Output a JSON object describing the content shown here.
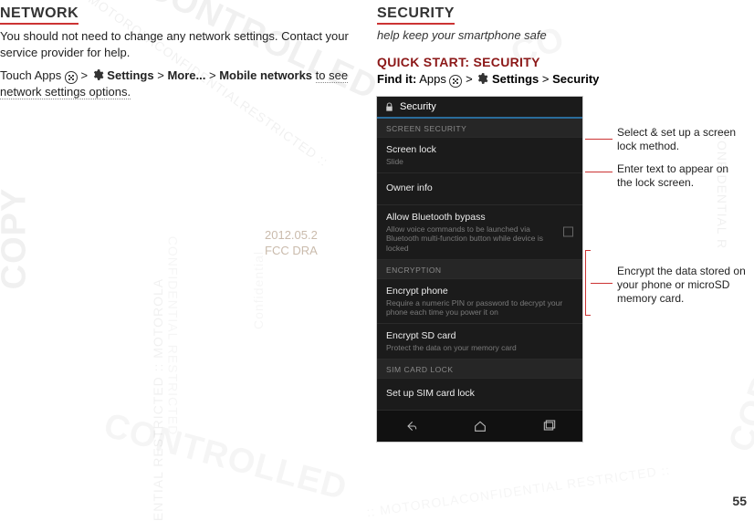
{
  "network": {
    "heading": "NETWORK",
    "body1": "You should not need to change any network settings. Contact your service provider for help.",
    "body2_pre": "Touch Apps ",
    "body2_gt1": " > ",
    "settings_label": "Settings",
    "body2_gt2": " > ",
    "more_label": "More...",
    "body2_gt3": " > ",
    "mobile_networks_label": "Mobile networks",
    "body2_post": " to see network settings options."
  },
  "security": {
    "heading": "SECURITY",
    "subtitle": "help keep your smartphone safe",
    "quick_heading": "QUICK START: SECURITY",
    "findit_label": "Find it:",
    "findit_apps": " Apps ",
    "findit_gt1": " > ",
    "findit_settings": "Settings",
    "findit_gt2": " > ",
    "findit_security": "Security"
  },
  "phone": {
    "title": "Security",
    "sec_screen": "SCREEN SECURITY",
    "screen_lock": {
      "label": "Screen lock",
      "sub": "Slide"
    },
    "owner_info": {
      "label": "Owner info"
    },
    "bt_bypass": {
      "label": "Allow Bluetooth bypass",
      "sub": "Allow voice commands to be launched via Bluetooth multi-function button while device is locked"
    },
    "sec_encryption": "ENCRYPTION",
    "encrypt_phone": {
      "label": "Encrypt phone",
      "sub": "Require a numeric PIN or password to decrypt your phone each time you power it on"
    },
    "encrypt_sd": {
      "label": "Encrypt SD card",
      "sub": "Protect the data on your memory card"
    },
    "sec_sim": "SIM CARD LOCK",
    "sim_lock": {
      "label": "Set up SIM card lock"
    }
  },
  "callouts": {
    "c1": "Select & set up a screen lock method.",
    "c2": "Enter text to appear on the lock screen.",
    "c3": "Encrypt the data stored on your phone or microSD memory card."
  },
  "fcc": {
    "line1": "2012.05.2",
    "line2": "FCC DRA"
  },
  "page_number": "55"
}
